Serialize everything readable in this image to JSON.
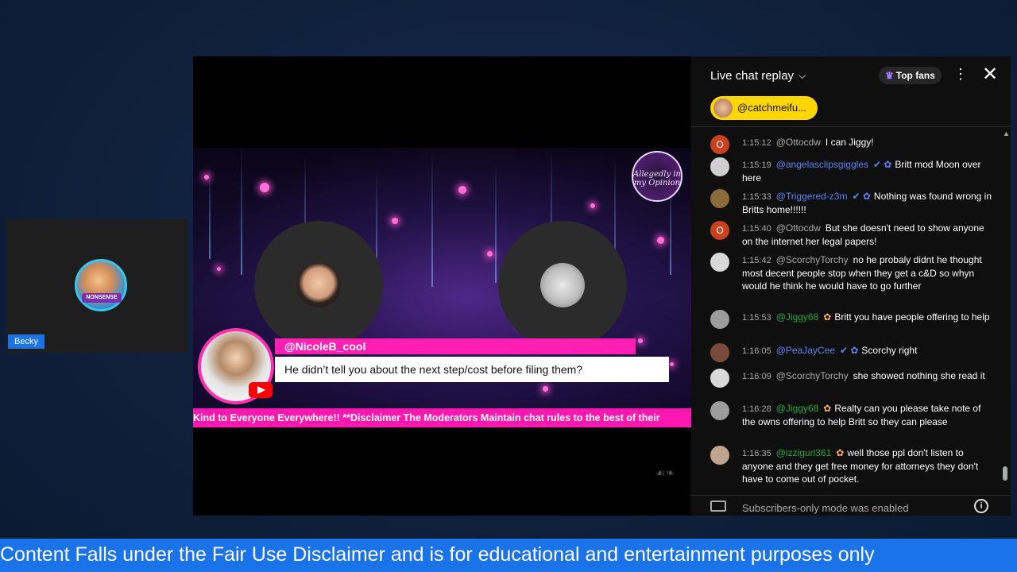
{
  "webcam": {
    "name": "Becky",
    "avatar_badge": "NONSENSE"
  },
  "stream": {
    "logo_text": "Allegedly in my Opinion",
    "comment_author": "@NicoleB_cool",
    "comment_text": "He didn’t tell you about the next step/cost before filing them?",
    "ticker": "Kind to Everyone Everywhere!! **Disclaimer The Moderators Maintain chat rules to the best of their"
  },
  "chat": {
    "title": "Live chat replay",
    "top_fans_label": "Top fans",
    "pinned_user": "@catchmeifu...",
    "footer_text": "Subscribers-only mode was enabled",
    "messages": [
      {
        "time": "1:15:12",
        "author": "@Ottocdw",
        "author_type": "normal",
        "badges": "",
        "text": "I can Jiggy!",
        "avatar_color": "#c9411e",
        "avatar_letter": "O"
      },
      {
        "time": "1:15:19",
        "author": "@angelasclipsgiggles",
        "author_type": "mod",
        "badges": "✔ ✿",
        "text": "Britt mod Moon over here",
        "avatar_color": "#cfcfcf",
        "avatar_letter": ""
      },
      {
        "time": "1:15:33",
        "author": "@Triggered-z3m",
        "author_type": "mod",
        "badges": "✔ ✿",
        "text": "Nothing was found wrong in Britts home!!!!!!",
        "avatar_color": "#8a6b3c",
        "avatar_letter": ""
      },
      {
        "time": "1:15:40",
        "author": "@Ottocdw",
        "author_type": "normal",
        "badges": "",
        "text": "But she doesn't need to show anyone on the internet her legal papers!",
        "avatar_color": "#c9411e",
        "avatar_letter": "O"
      },
      {
        "time": "1:15:42",
        "author": "@ScorchyTorchy",
        "author_type": "normal",
        "badges": "",
        "text": "no he probaly didnt he thought most decent people stop when they get a c&D so whyn would he think he would have to go further",
        "avatar_color": "#d8d8d8",
        "avatar_letter": ""
      },
      {
        "time": "1:15:53",
        "author": "@Jiggy68",
        "author_type": "member",
        "badges": "✿",
        "text": "Britt you have people offering to help",
        "avatar_color": "#9c9c9c",
        "avatar_letter": ""
      },
      {
        "time": "1:16:05",
        "author": "@PeaJayCee",
        "author_type": "mod",
        "badges": "✔ ✿",
        "text": "Scorchy right",
        "avatar_color": "#7a4a3a",
        "avatar_letter": ""
      },
      {
        "time": "1:16:09",
        "author": "@ScorchyTorchy",
        "author_type": "normal",
        "badges": "",
        "text": "she showed nothing she read it",
        "avatar_color": "#d8d8d8",
        "avatar_letter": ""
      },
      {
        "time": "1:16:28",
        "author": "@Jiggy68",
        "author_type": "member",
        "badges": "✿",
        "text": "Realty can you please take note of the owns offering to help Britt so they can please",
        "avatar_color": "#9c9c9c",
        "avatar_letter": ""
      },
      {
        "time": "1:16:35",
        "author": "@izzigurl361",
        "author_type": "member",
        "badges": "✿",
        "text": "well those ppl don't listen to anyone and they get free money for attorneys they don't have to come out of pocket.",
        "avatar_color": "#bfa58f",
        "avatar_letter": ""
      }
    ]
  },
  "banner": {
    "text": "Content Falls under the Fair Use Disclaimer and is for educational and entertainment purposes only"
  }
}
